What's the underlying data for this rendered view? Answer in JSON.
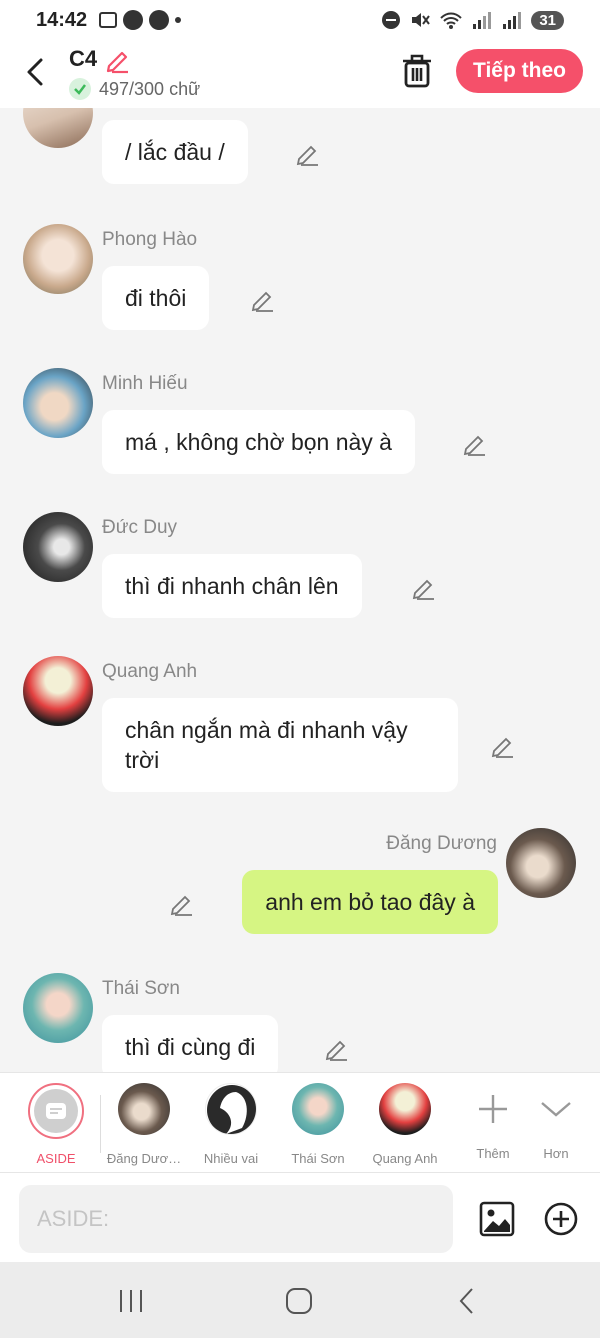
{
  "status_bar": {
    "time": "14:42",
    "battery": "31"
  },
  "header": {
    "title": "C4",
    "word_count": "497/300 chữ",
    "next_label": "Tiếp theo"
  },
  "messages": [
    {
      "name": "",
      "text": "/ lắc đầu /"
    },
    {
      "name": "Phong Hào",
      "text": "đi thôi"
    },
    {
      "name": "Minh Hiếu",
      "text": "má , không chờ bọn này à"
    },
    {
      "name": "Đức Duy",
      "text": "thì đi nhanh chân lên"
    },
    {
      "name": "Quang Anh",
      "text": "chân ngắn mà đi nhanh vậy trời"
    },
    {
      "name": "Đăng Dương",
      "text": "anh em bỏ tao đây à"
    },
    {
      "name": "Thái Sơn",
      "text": "thì đi cùng đi"
    }
  ],
  "characters": [
    {
      "label": "ASIDE"
    },
    {
      "label": "Đăng Dươ…"
    },
    {
      "label": "Nhiều vai"
    },
    {
      "label": "Thái Sơn"
    },
    {
      "label": "Quang Anh"
    },
    {
      "label": "Thêm"
    },
    {
      "label": "Hơn"
    }
  ],
  "input": {
    "placeholder": "ASIDE:"
  },
  "colors": {
    "accent": "#f5506a",
    "my_bubble": "#d6f583",
    "bg": "#f4f4f4"
  }
}
